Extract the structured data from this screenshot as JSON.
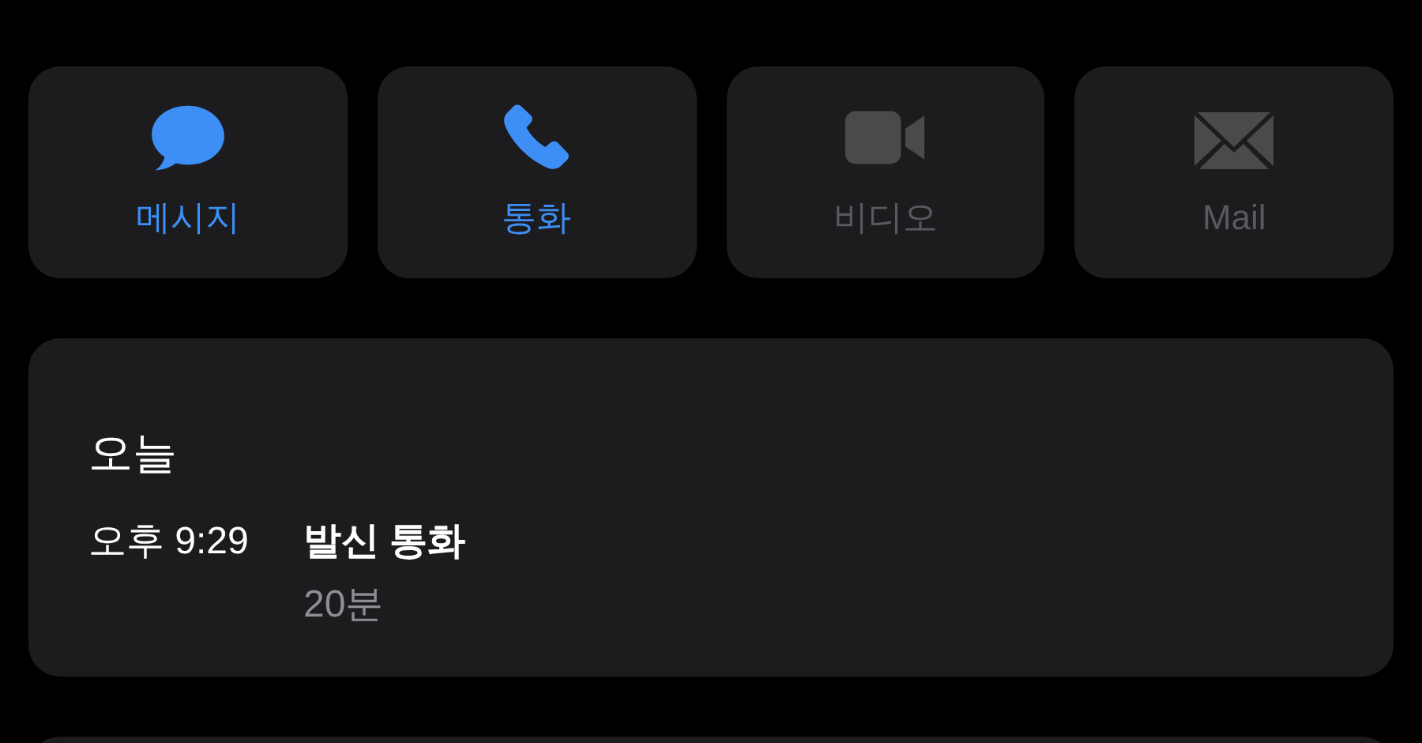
{
  "actions": [
    {
      "kind": "message",
      "label": "메시지",
      "disabled": false
    },
    {
      "kind": "phone",
      "label": "통화",
      "disabled": false
    },
    {
      "kind": "video",
      "label": "비디오",
      "disabled": true
    },
    {
      "kind": "mail",
      "label": "Mail",
      "disabled": true
    }
  ],
  "history": {
    "heading": "오늘",
    "entries": [
      {
        "time": "오후 9:29",
        "type": "발신 통화",
        "duration": "20분"
      }
    ]
  }
}
